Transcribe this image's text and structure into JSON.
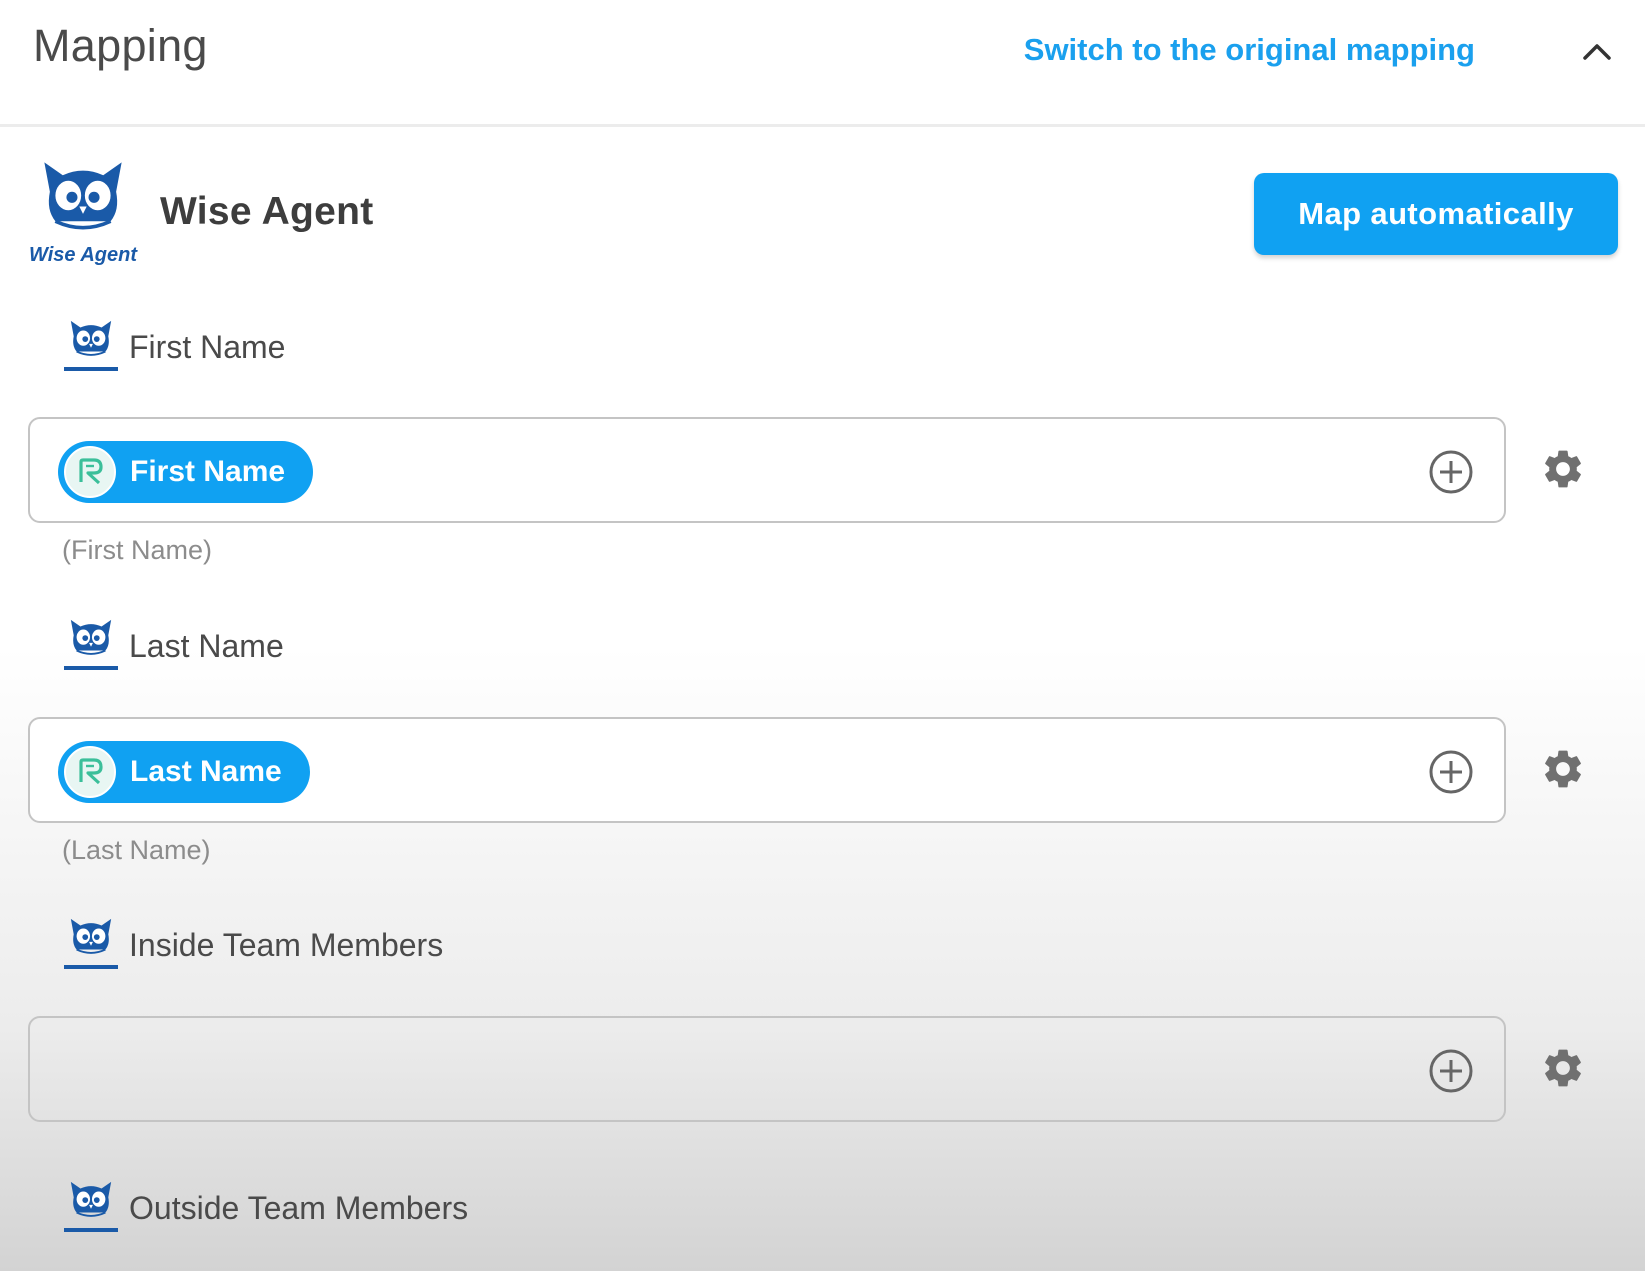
{
  "header": {
    "title": "Mapping",
    "switch_link": "Switch to the original mapping",
    "collapse_icon": "chevron-up-icon"
  },
  "app": {
    "name": "Wise Agent",
    "logo_text": "Wise Agent",
    "map_button": "Map automatically"
  },
  "colors": {
    "accent": "#10a1f2",
    "link": "#1aa0ee",
    "logo_blue": "#1a5aa8"
  },
  "fields": [
    {
      "label": "First Name",
      "chip": "First Name",
      "hint": "(First Name)"
    },
    {
      "label": "Last Name",
      "chip": "Last Name",
      "hint": "(Last Name)"
    },
    {
      "label": "Inside Team Members",
      "chip": null,
      "hint": null
    },
    {
      "label": "Outside Team Members",
      "chip": null,
      "hint": null
    }
  ],
  "icons": {
    "add": "plus-circle-icon",
    "settings": "gear-icon",
    "chip_source": "source-app-icon",
    "field_logo": "wise-agent-logo-icon"
  }
}
